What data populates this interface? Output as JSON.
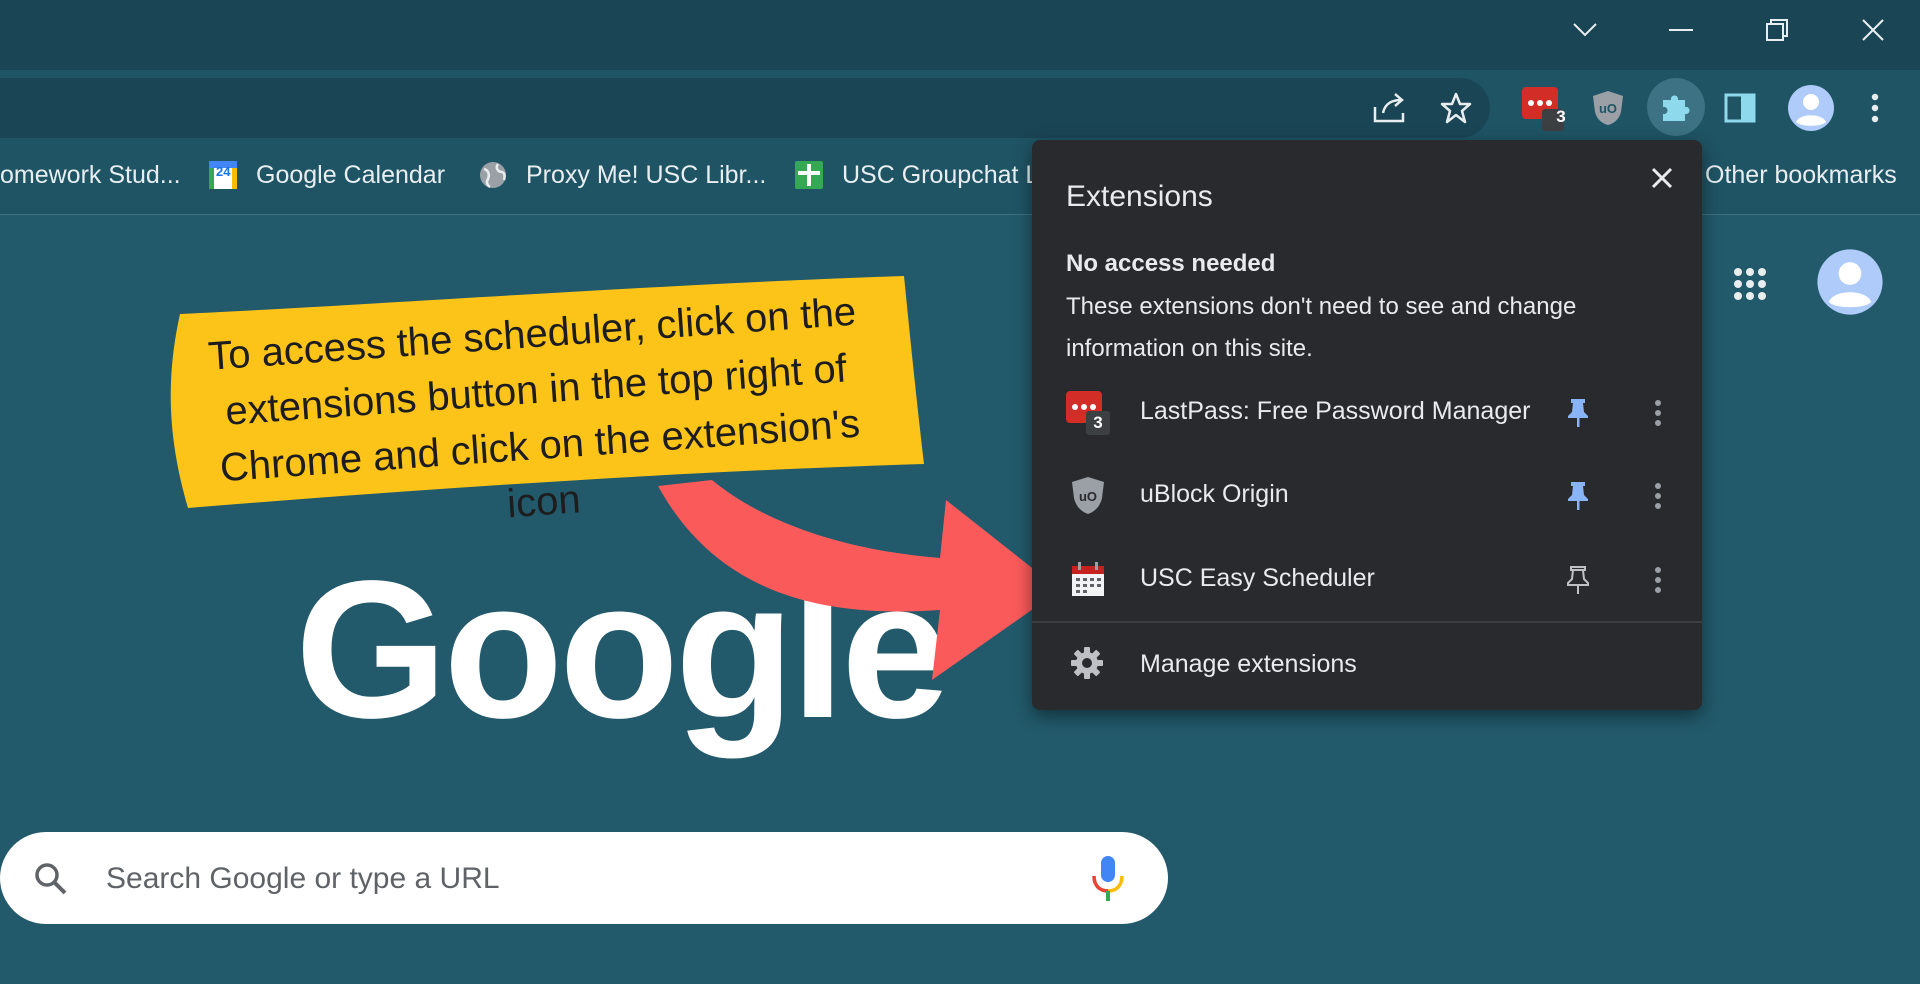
{
  "window": {
    "tab_search_icon": "chevron-down-icon",
    "minimize_icon": "minimize-icon",
    "restore_icon": "restore-icon",
    "close_icon": "close-icon"
  },
  "toolbar": {
    "share_icon": "share-icon",
    "bookmark_star_icon": "star-icon",
    "lastpass_badge": "3",
    "extensions_icon": "puzzle-icon",
    "side_panel_icon": "side-panel-icon",
    "profile_icon": "avatar-icon",
    "menu_icon": "vertical-dots-icon"
  },
  "bookmarks": {
    "items": [
      {
        "label": "omework Stud..."
      },
      {
        "label": "Google Calendar",
        "badge": "24"
      },
      {
        "label": "Proxy Me! USC Libr..."
      },
      {
        "label": "USC Groupchat L"
      }
    ],
    "other": "Other bookmarks"
  },
  "extensions_popup": {
    "title": "Extensions",
    "section_heading": "No access needed",
    "section_description": "These extensions don't need to see and change information on this site.",
    "items": [
      {
        "name": "LastPass: Free Password Manager",
        "badge": "3",
        "pinned": true
      },
      {
        "name": "uBlock Origin",
        "badge": "",
        "pinned": true
      },
      {
        "name": "USC Easy Scheduler",
        "badge": "",
        "pinned": false
      }
    ],
    "manage_label": "Manage extensions"
  },
  "annotation": {
    "text": "To access the scheduler, click on the extensions button in the top right of Chrome and click on the extension's icon"
  },
  "new_tab": {
    "logo": "Google",
    "search_placeholder": "Search Google or type a URL",
    "apps_icon": "apps-grid-icon",
    "account_icon": "avatar-icon"
  },
  "colors": {
    "page_bg": "#225a6b",
    "titlebar_bg": "#1a4555",
    "toolbar_bg": "#1f5465",
    "popup_bg": "#292a2d",
    "note_bg": "#fcc419",
    "arrow": "#fb5a5a",
    "pin_active": "#8ab4f8",
    "lastpass_red": "#d32d27"
  }
}
